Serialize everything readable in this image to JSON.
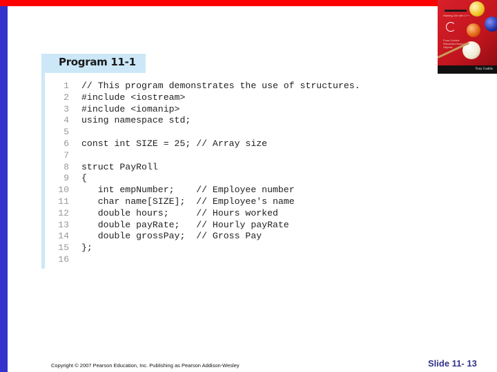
{
  "header": {
    "program_title": "Program 11-1"
  },
  "book_cover": {
    "title_text": "Starting Out with C++",
    "subtitle_text": "From Control Structures through Objects",
    "author": "Tony Gaddis",
    "colors": {
      "background": "#d8202a"
    }
  },
  "code": {
    "lines": [
      {
        "number": "1",
        "text": "// This program demonstrates the use of structures."
      },
      {
        "number": "2",
        "text": "#include <iostream>"
      },
      {
        "number": "3",
        "text": "#include <iomanip>"
      },
      {
        "number": "4",
        "text": "using namespace std;"
      },
      {
        "number": "5",
        "text": ""
      },
      {
        "number": "6",
        "text": "const int SIZE = 25; // Array size"
      },
      {
        "number": "7",
        "text": ""
      },
      {
        "number": "8",
        "text": "struct PayRoll"
      },
      {
        "number": "9",
        "text": "{"
      },
      {
        "number": "10",
        "text": "   int empNumber;    // Employee number"
      },
      {
        "number": "11",
        "text": "   char name[SIZE];  // Employee's name"
      },
      {
        "number": "12",
        "text": "   double hours;     // Hours worked"
      },
      {
        "number": "13",
        "text": "   double payRate;   // Hourly payRate"
      },
      {
        "number": "14",
        "text": "   double grossPay;  // Gross Pay"
      },
      {
        "number": "15",
        "text": "};"
      },
      {
        "number": "16",
        "text": ""
      }
    ]
  },
  "footer": {
    "copyright": "Copyright © 2007 Pearson Education, Inc. Publishing as Pearson Addison-Wesley",
    "slide_number": "Slide 11- 13"
  },
  "colors": {
    "top_bar": "#ff0000",
    "left_bar": "#3333cc",
    "header_bg": "#cce8f8",
    "slide_number": "#333388"
  }
}
